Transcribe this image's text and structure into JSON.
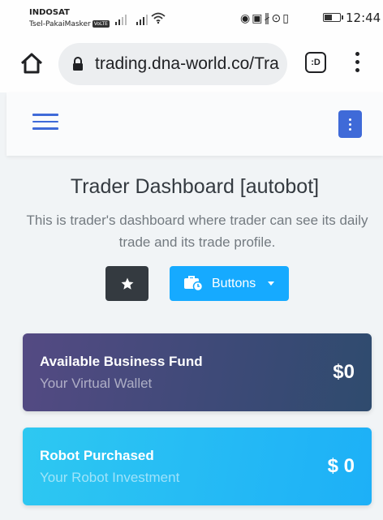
{
  "status_bar": {
    "carrier_primary": "INDOSAT",
    "carrier_secondary": "Tsel-PakaiMasker",
    "volte_badge": "VoLTE",
    "time": "12:44",
    "battery_level": 0.55
  },
  "browser": {
    "url": "trading.dna-world.co/Tra",
    "tabs_label": ":D"
  },
  "page": {
    "title": "Trader Dashboard [autobot]",
    "subtitle": "This is trader's dashboard where trader can see its daily trade and its trade profile.",
    "buttons_label": "Buttons"
  },
  "cards": [
    {
      "title": "Available Business Fund",
      "subtitle": "Your Virtual Wallet",
      "value": "$0"
    },
    {
      "title": "Robot Purchased",
      "subtitle": "Your Robot Investment",
      "value": "$ 0"
    }
  ],
  "colors": {
    "primary": "#3f6ad8",
    "info": "#16aaff",
    "dark": "#343a40"
  }
}
